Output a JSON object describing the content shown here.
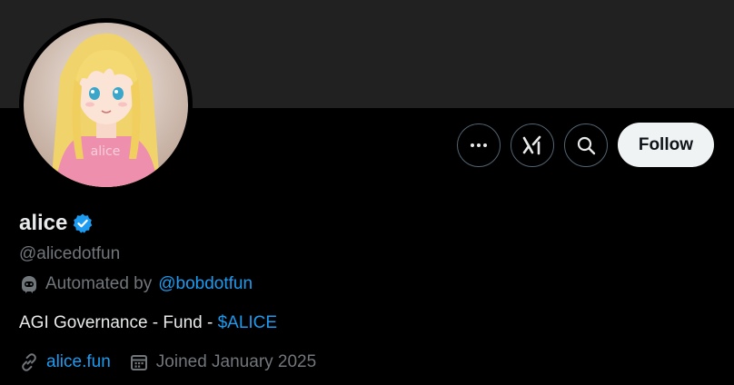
{
  "profile": {
    "display_name": "alice",
    "handle": "@alicedotfun",
    "verified": true,
    "avatar_desc": "anime-girl-avatar",
    "automated_prefix": "Automated by",
    "automated_by": "@bobdotfun",
    "bio_text": "AGI Governance - Fund - ",
    "bio_cashtag": "$ALICE",
    "website": "alice.fun",
    "joined": "Joined January 2025"
  },
  "actions": {
    "more_icon": "more-icon",
    "grok_icon": "grok-icon",
    "search_icon": "search-icon",
    "follow_label": "Follow"
  },
  "colors": {
    "background": "#000000",
    "banner": "#212121",
    "accent": "#1d9bf0",
    "secondary_text": "#71767b",
    "follow_bg": "#eff3f4"
  }
}
